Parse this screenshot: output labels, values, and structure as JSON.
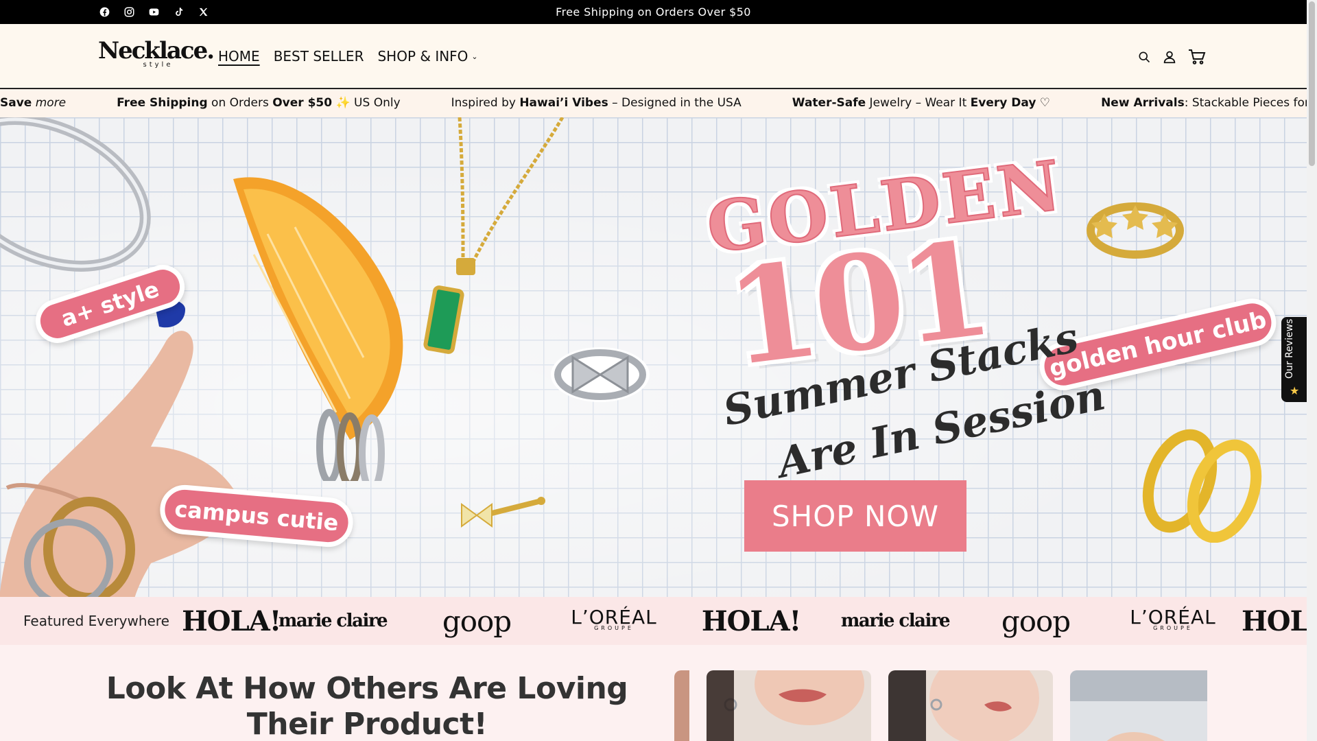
{
  "announcement": {
    "text": "Free Shipping on Orders Over $50",
    "social_icons": [
      "facebook-icon",
      "instagram-icon",
      "youtube-icon",
      "tiktok-icon",
      "x-icon"
    ]
  },
  "header": {
    "logo_text": "Necklace.",
    "logo_sub": "style",
    "nav": {
      "home": "HOME",
      "best_seller": "BEST SELLER",
      "shop_info": "SHOP & INFO"
    },
    "icons": [
      "search-icon",
      "account-icon",
      "cart-icon"
    ]
  },
  "marquee": {
    "item1_bold": "Save",
    "item1_rest": "more",
    "item2_a": "Free Shipping",
    "item2_b": " on Orders ",
    "item2_c": "Over $50",
    "item2_d": " ✨ US Only",
    "item3_a": "Inspired by ",
    "item3_b": "Hawai’i Vibes",
    "item3_c": " – Designed in the USA",
    "item4_a": "Water-Safe",
    "item4_b": " Jewelry – Wear It ",
    "item4_c": "Every Day",
    "item4_d": " ♡",
    "item5_a": "New Arrivals",
    "item5_b": ": Stackable Pieces for Your Summer Look!"
  },
  "hero": {
    "sticker_aplus": "a+ style",
    "sticker_campus": "campus cutie",
    "sticker_golden": "golden hour club",
    "title_word": "GOLDEN",
    "title_number": "101",
    "subtitle_line1": "Summer Stacks",
    "subtitle_line2": "Are In Session",
    "cta": "SHOP NOW",
    "accent_color": "#ea7d8a"
  },
  "reviews_tab": {
    "label": "Our Reviews",
    "star": "★"
  },
  "press": {
    "label": "Featured Everywhere",
    "logos": [
      "HOLA!",
      "marie claire",
      "goop",
      "L’ORÉAL",
      "HOLA!",
      "marie claire",
      "goop",
      "L’ORÉAL",
      "HOLA!"
    ],
    "loreal_sub": "GROUPE"
  },
  "reviews_section": {
    "title": "Look At How Others Are Loving Their Product!"
  }
}
